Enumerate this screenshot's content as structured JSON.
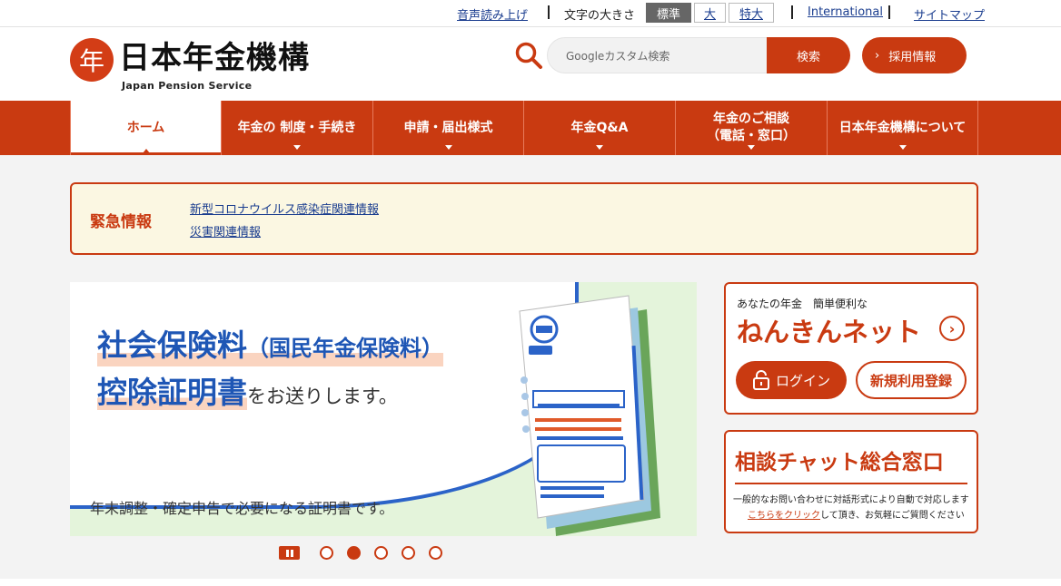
{
  "utility": {
    "read_aloud": "音声読み上げ",
    "font_size_label": "文字の大きさ",
    "font_sizes": [
      "標準",
      "大",
      "特大"
    ],
    "font_size_selected": "標準",
    "international": "International",
    "sitemap": "サイトマップ"
  },
  "header": {
    "logo_mark": "年",
    "logo_title": "日本年金機構",
    "logo_subtitle": "Japan Pension Service",
    "search_placeholder": "Googleカスタム検索",
    "search_button": "検索",
    "recruit_button": "採用情報"
  },
  "nav": {
    "items": [
      {
        "label": "ホーム",
        "label2": "",
        "active": true
      },
      {
        "label": "年金の 制度・手続き",
        "label2": "",
        "active": false
      },
      {
        "label": "申請・届出様式",
        "label2": "",
        "active": false
      },
      {
        "label": "年金Q&A",
        "label2": "",
        "active": false
      },
      {
        "label": "年金のご相談",
        "label2": "（電話・窓口）",
        "active": false
      },
      {
        "label": "日本年金機構について",
        "label2": "",
        "active": false
      }
    ]
  },
  "emergency": {
    "title": "緊急情報",
    "links": [
      "新型コロナウイルス感染症関連情報",
      "災害関連情報"
    ]
  },
  "banner": {
    "line1_main": "社会保険料",
    "line1_paren": "（国民年金保険料）",
    "line2_main": "控除証明書",
    "line2_tail": "をお送りします。",
    "caption": "年末調整・確定申告で必要になる証明書です。",
    "slide_count": 5,
    "active_slide": 2
  },
  "nenkin_net": {
    "subtitle": "あなたの年金　簡単便利な",
    "title": "ねんきんネット",
    "login": "ログイン",
    "register": "新規利用登録"
  },
  "chat": {
    "title": "相談チャット総合窓口",
    "desc1": "一般的なお問い合わせに対話形式により自動で対応します",
    "link": "こちらをクリック",
    "desc2": "して頂き、お気軽にご質問ください"
  },
  "colors": {
    "brand": "#c93a11",
    "link": "#1a3d8f",
    "banner_blue": "#1e56b5",
    "banner_bg": "#e4f4db",
    "emergency_bg": "#fbf7e2"
  }
}
